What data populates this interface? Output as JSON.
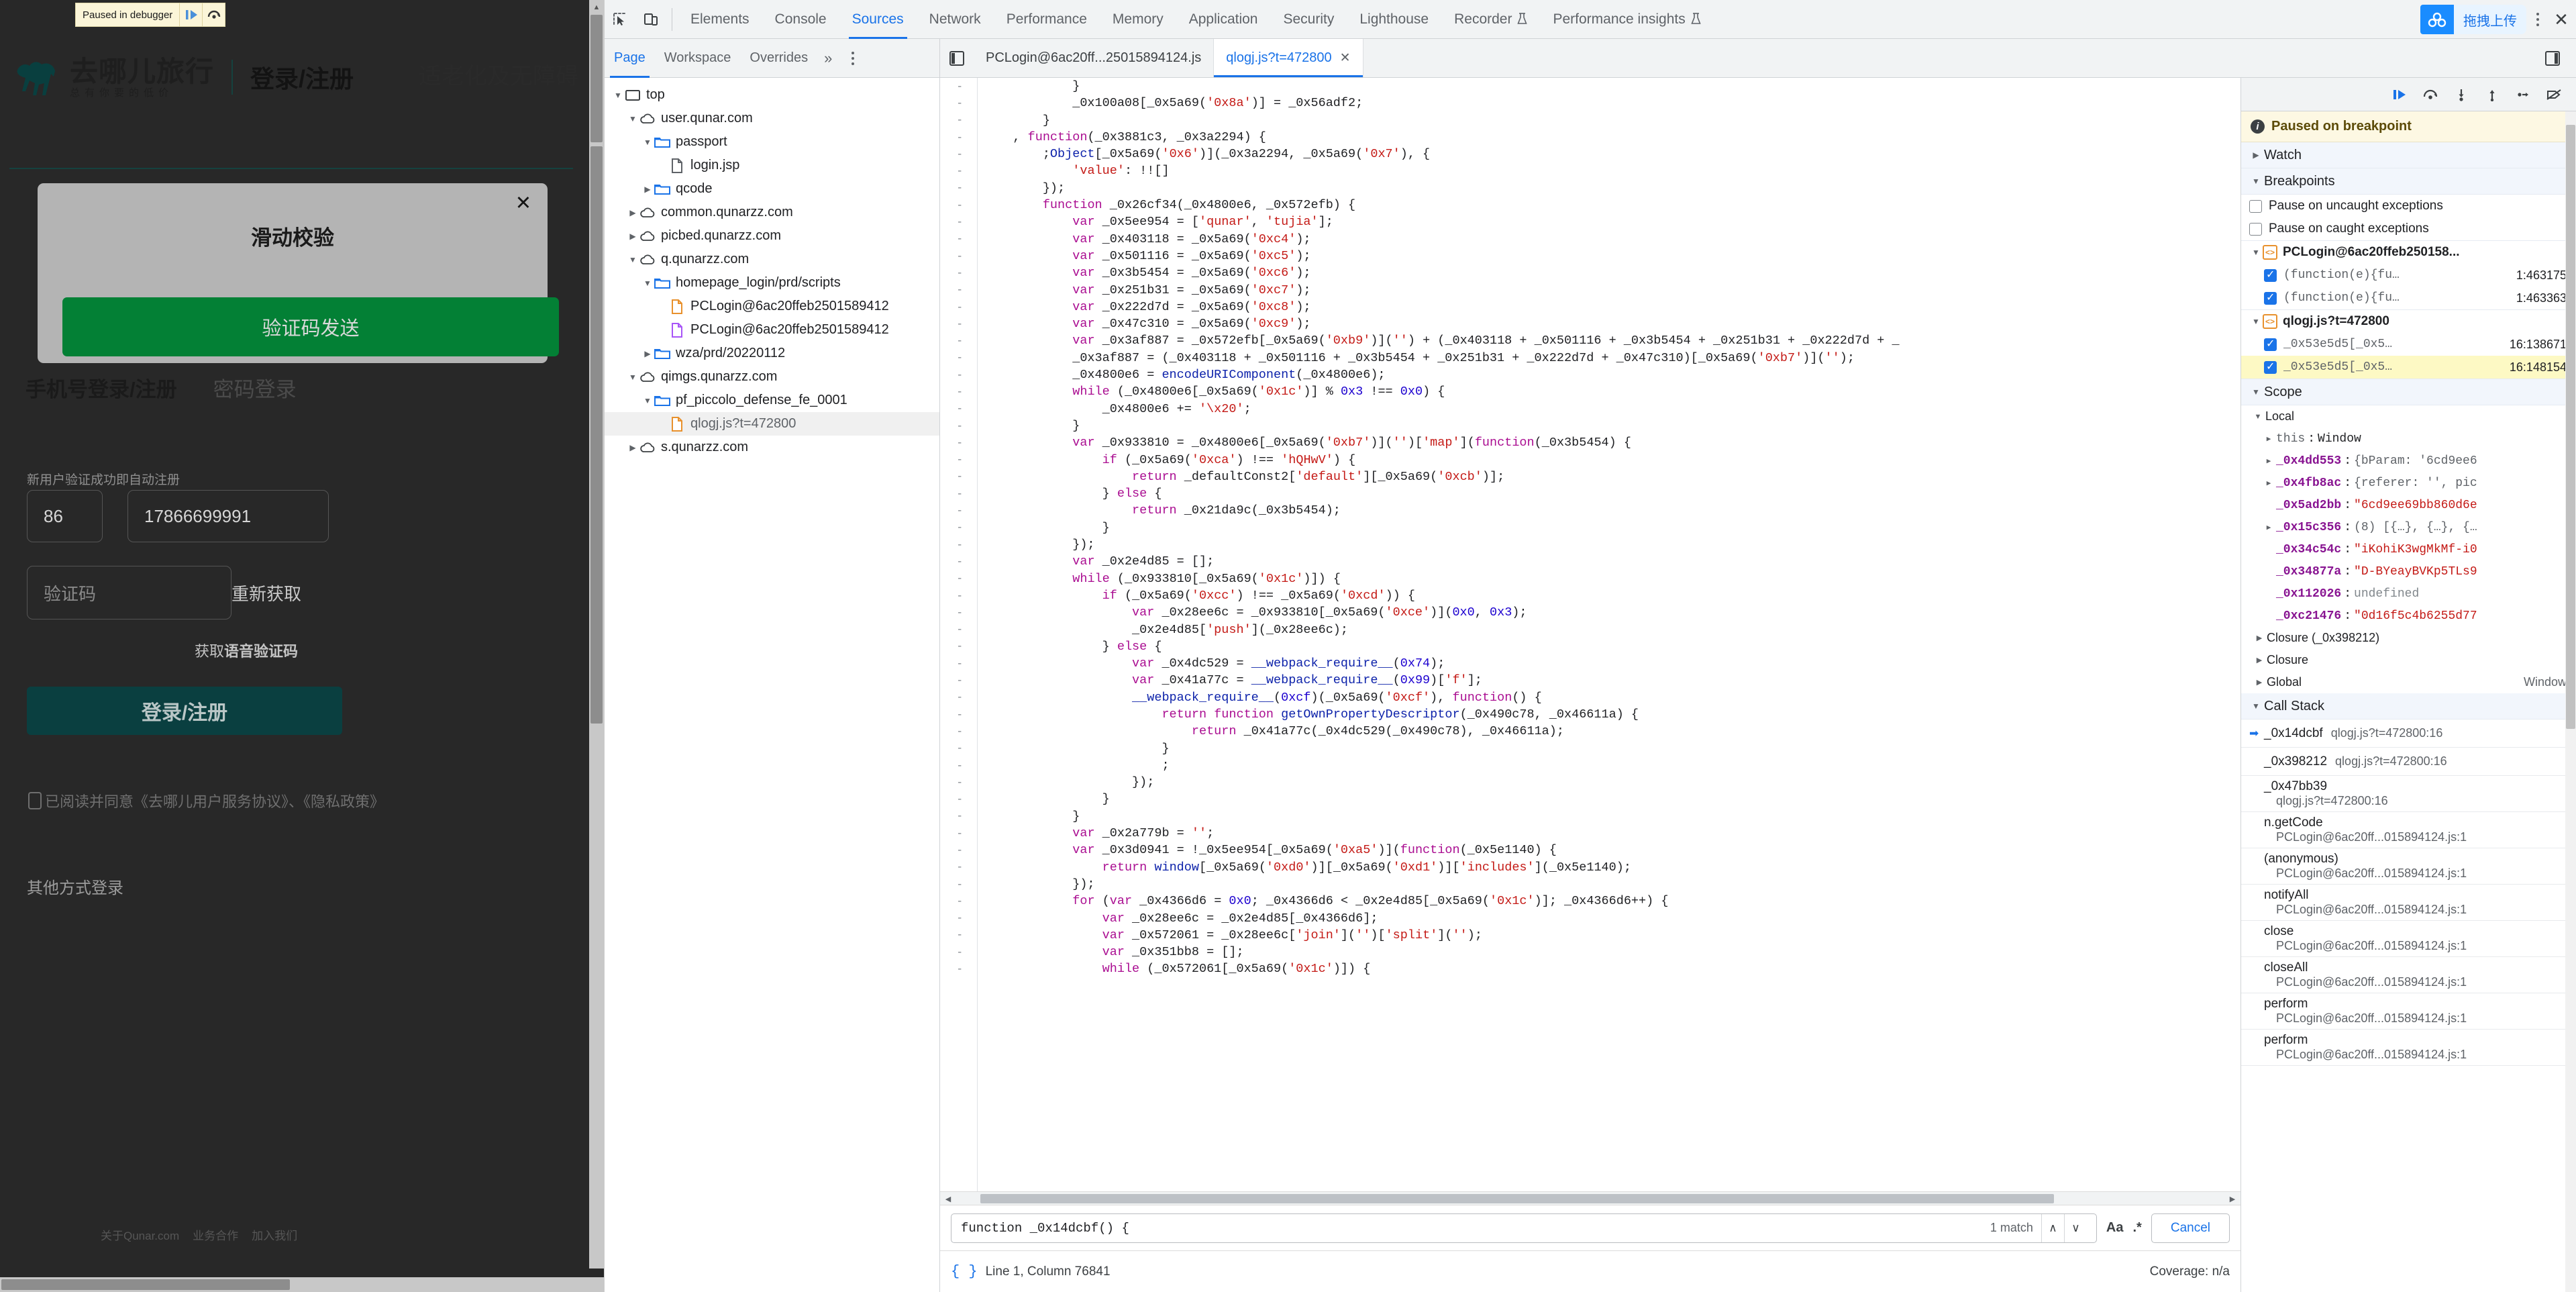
{
  "page": {
    "brand": {
      "name": "去哪儿旅行",
      "slogan": "总有你要的低价"
    },
    "header": {
      "login_word": "登录/注册",
      "accessibility": "适老化及无障碍"
    },
    "paused_banner": {
      "text": "Paused in debugger",
      "resume_icon": "resume-script-icon",
      "step_icon": "step-over-icon"
    },
    "verify_modal": {
      "title": "滑动校验",
      "slider_text": "验证码发送",
      "close_icon": "close-icon"
    },
    "tabs": {
      "active": "手机号登录/注册",
      "inactive": "密码登录"
    },
    "hint": "新用户验证成功即自动注册",
    "country_code": "86",
    "phone": "17866699991",
    "code_placeholder": "验证码",
    "resend": "重新获取",
    "voice_prefix": "获取",
    "voice_bold": "语音验证码",
    "login_button": "登录/注册",
    "agreement": "已阅读并同意《去哪儿用户服务协议》、《隐私政策》",
    "other_login": "其他方式登录",
    "footer": [
      "关于Qunar.com",
      "业务合作",
      "加入我们"
    ]
  },
  "devtools": {
    "left_icons": [
      "inspect-element-icon",
      "device-toolbar-icon"
    ],
    "panels": [
      {
        "label": "Elements",
        "active": false,
        "flask": false
      },
      {
        "label": "Console",
        "active": false,
        "flask": false
      },
      {
        "label": "Sources",
        "active": true,
        "flask": false
      },
      {
        "label": "Network",
        "active": false,
        "flask": false
      },
      {
        "label": "Performance",
        "active": false,
        "flask": false
      },
      {
        "label": "Memory",
        "active": false,
        "flask": false
      },
      {
        "label": "Application",
        "active": false,
        "flask": false
      },
      {
        "label": "Security",
        "active": false,
        "flask": false
      },
      {
        "label": "Lighthouse",
        "active": false,
        "flask": false
      },
      {
        "label": "Recorder",
        "active": false,
        "flask": true
      },
      {
        "label": "Performance insights",
        "active": false,
        "flask": true
      }
    ],
    "upload_chip": {
      "label": "拖拽上传",
      "icon": "cloud-upload-icon"
    },
    "more_icon": "more-vertical-icon",
    "close_icon": "close-devtools-icon",
    "nav_tabs": [
      {
        "label": "Page",
        "active": true
      },
      {
        "label": "Workspace",
        "active": false
      },
      {
        "label": "Overrides",
        "active": false
      }
    ],
    "nav_more": "»",
    "nav_menu_icon": "more-vertical-icon",
    "panel_toggle_icon": "toggle-navigator-icon",
    "file_tabs": [
      {
        "label": "PCLogin@6ac20ff...25015894124.js",
        "active": false,
        "closable": false
      },
      {
        "label": "qlogj.js?t=472800",
        "active": true,
        "closable": true
      }
    ],
    "tree": [
      {
        "depth": 0,
        "twisty": "down",
        "icon": "frame-icon",
        "label": "top"
      },
      {
        "depth": 1,
        "twisty": "down",
        "icon": "cloud-icon",
        "label": "user.qunar.com"
      },
      {
        "depth": 2,
        "twisty": "down",
        "icon": "folder-blue-icon",
        "label": "passport"
      },
      {
        "depth": 3,
        "twisty": "none",
        "icon": "file-gray-icon",
        "label": "login.jsp"
      },
      {
        "depth": 2,
        "twisty": "right",
        "icon": "folder-blue-icon",
        "label": "qcode"
      },
      {
        "depth": 1,
        "twisty": "right",
        "icon": "cloud-icon",
        "label": "common.qunarzz.com"
      },
      {
        "depth": 1,
        "twisty": "right",
        "icon": "cloud-icon",
        "label": "picbed.qunarzz.com"
      },
      {
        "depth": 1,
        "twisty": "down",
        "icon": "cloud-icon",
        "label": "q.qunarzz.com"
      },
      {
        "depth": 2,
        "twisty": "down",
        "icon": "folder-blue-icon",
        "label": "homepage_login/prd/scripts"
      },
      {
        "depth": 3,
        "twisty": "none",
        "icon": "file-orange-icon",
        "label": "PCLogin@6ac20ffeb2501589412"
      },
      {
        "depth": 3,
        "twisty": "none",
        "icon": "file-purple-icon",
        "label": "PCLogin@6ac20ffeb2501589412"
      },
      {
        "depth": 2,
        "twisty": "right",
        "icon": "folder-blue-icon",
        "label": "wza/prd/20220112"
      },
      {
        "depth": 1,
        "twisty": "down",
        "icon": "cloud-icon",
        "label": "qimgs.qunarzz.com"
      },
      {
        "depth": 2,
        "twisty": "down",
        "icon": "folder-blue-icon",
        "label": "pf_piccolo_defense_fe_0001"
      },
      {
        "depth": 3,
        "twisty": "none",
        "icon": "file-orange-icon",
        "label": "qlogj.js?t=472800",
        "selected": true
      },
      {
        "depth": 1,
        "twisty": "right",
        "icon": "cloud-icon",
        "label": "s.qunarzz.com"
      }
    ],
    "code_lines": [
      "            }",
      "            _0x100a08[_0x5a69('0x8a')] = _0x56adf2;",
      "        }",
      "    , function(_0x3881c3, _0x3a2294) {",
      "        ;Object[_0x5a69('0x6')](_0x3a2294, _0x5a69('0x7'), {",
      "            'value': !![]",
      "        });",
      "        function _0x26cf34(_0x4800e6, _0x572efb) {",
      "            var _0x5ee954 = ['qunar', 'tujia'];",
      "            var _0x403118 = _0x5a69('0xc4');",
      "            var _0x501116 = _0x5a69('0xc5');",
      "            var _0x3b5454 = _0x5a69('0xc6');",
      "            var _0x251b31 = _0x5a69('0xc7');",
      "            var _0x222d7d = _0x5a69('0xc8');",
      "            var _0x47c310 = _0x5a69('0xc9');",
      "            var _0x3af887 = _0x572efb[_0x5a69('0xb9')]('') + (_0x403118 + _0x501116 + _0x3b5454 + _0x251b31 + _0x222d7d + _",
      "            _0x3af887 = (_0x403118 + _0x501116 + _0x3b5454 + _0x251b31 + _0x222d7d + _0x47c310)[_0x5a69('0xb7')]('');",
      "            _0x4800e6 = encodeURIComponent(_0x4800e6);",
      "            while (_0x4800e6[_0x5a69('0x1c')] % 0x3 !== 0x0) {",
      "                _0x4800e6 += '\\x20';",
      "            }",
      "            var _0x933810 = _0x4800e6[_0x5a69('0xb7')]('')['map'](function(_0x3b5454) {",
      "                if (_0x5a69('0xca') !== 'hQHwV') {",
      "                    return _defaultConst2['default'][_0x5a69('0xcb')];",
      "                } else {",
      "                    return _0x21da9c(_0x3b5454);",
      "                }",
      "            });",
      "            var _0x2e4d85 = [];",
      "            while (_0x933810[_0x5a69('0x1c')]) {",
      "                if (_0x5a69('0xcc') !== _0x5a69('0xcd')) {",
      "                    var _0x28ee6c = _0x933810[_0x5a69('0xce')](0x0, 0x3);",
      "                    _0x2e4d85['push'](_0x28ee6c);",
      "                } else {",
      "                    var _0x4dc529 = __webpack_require__(0x74);",
      "                    var _0x41a77c = __webpack_require__(0x99)['f'];",
      "                    __webpack_require__(0xcf)(_0x5a69('0xcf'), function() {",
      "                        return function getOwnPropertyDescriptor(_0x490c78, _0x46611a) {",
      "                            return _0x41a77c(_0x4dc529(_0x490c78), _0x46611a);",
      "                        }",
      "                        ;",
      "                    });",
      "                }",
      "            }",
      "            var _0x2a779b = '';",
      "            var _0x3d0941 = !_0x5ee954[_0x5a69('0xa5')](function(_0x5e1140) {",
      "                return window[_0x5a69('0xd0')][_0x5a69('0xd1')]['includes'](_0x5e1140);",
      "            });",
      "            for (var _0x4366d6 = 0x0; _0x4366d6 < _0x2e4d85[_0x5a69('0x1c')]; _0x4366d6++) {",
      "                var _0x28ee6c = _0x2e4d85[_0x4366d6];",
      "                var _0x572061 = _0x28ee6c['join']('')['split']('');",
      "                var _0x351bb8 = [];",
      "                while (_0x572061[_0x5a69('0x1c')]) {"
    ],
    "search": {
      "query": "function _0x14dcbf() {",
      "match_count": "1 match",
      "prev_icon": "chevron-up-icon",
      "next_icon": "chevron-down-icon",
      "match_case_icon": "Aa",
      "regex_icon": ".*",
      "cancel_label": "Cancel"
    },
    "status": {
      "format_icon": "pretty-print-icon",
      "position": "Line 1, Column 76841",
      "coverage": "Coverage: n/a"
    },
    "debugger": {
      "toolbar_icons": [
        "resume-icon",
        "step-over-icon",
        "step-into-icon",
        "step-out-icon",
        "step-icon",
        "deactivate-breakpoints-icon"
      ],
      "paused_text": "Paused on breakpoint",
      "watch_label": "Watch",
      "breakpoints_label": "Breakpoints",
      "pause_uncaught": "Pause on uncaught exceptions",
      "pause_caught": "Pause on caught exceptions",
      "breakpoint_groups": [
        {
          "file": "PCLogin@6ac20ffeb250158...",
          "items": [
            {
              "code": "(function(e){fu…",
              "loc": "1:463175",
              "checked": true,
              "highlight": false
            },
            {
              "code": "(function(e){fu…",
              "loc": "1:463363",
              "checked": true,
              "highlight": false
            }
          ]
        },
        {
          "file": "qlogj.js?t=472800",
          "items": [
            {
              "code": "_0x53e5d5[_0x5…",
              "loc": "16:138671",
              "checked": true,
              "highlight": false
            },
            {
              "code": "_0x53e5d5[_0x5…",
              "loc": "16:148154",
              "checked": true,
              "highlight": true
            }
          ]
        }
      ],
      "scope_label": "Scope",
      "local_label": "Local",
      "scope_rows": [
        {
          "twisty": "right",
          "key": "this",
          "plain": true,
          "value": "Window",
          "kind": "plain"
        },
        {
          "twisty": "right",
          "key": "_0x4dd553",
          "value": "{bParam: '6cd9ee6",
          "kind": "obj"
        },
        {
          "twisty": "right",
          "key": "_0x4fb8ac",
          "value": "{referer: '', pic",
          "kind": "obj"
        },
        {
          "twisty": "none",
          "key": "_0x5ad2bb",
          "value": "\"6cd9ee69bb860d6e",
          "kind": "str"
        },
        {
          "twisty": "right",
          "key": "_0x15c356",
          "value": "(8) [{…}, {…}, {…",
          "kind": "obj"
        },
        {
          "twisty": "none",
          "key": "_0x34c54c",
          "value": "\"iKohiK3wgMkMf-i0",
          "kind": "str"
        },
        {
          "twisty": "none",
          "key": "_0x34877a",
          "value": "\"D-BYeayBVKp5TLs9",
          "kind": "str"
        },
        {
          "twisty": "none",
          "key": "_0x112026",
          "value": "undefined",
          "kind": "undef"
        },
        {
          "twisty": "none",
          "key": "_0xc21476",
          "value": "\"0d16f5c4b6255d77",
          "kind": "str"
        }
      ],
      "closures": [
        {
          "label": "Closure (_0x398212)"
        },
        {
          "label": "Closure"
        }
      ],
      "global": {
        "label": "Global",
        "value": "Window"
      },
      "call_stack_label": "Call Stack",
      "call_stack": [
        {
          "fn": "_0x14dcbf",
          "loc": "qlogj.js?t=472800:16",
          "current": true,
          "wrap": false
        },
        {
          "fn": "_0x398212",
          "loc": "qlogj.js?t=472800:16",
          "current": false,
          "wrap": false
        },
        {
          "fn": "_0x47bb39",
          "loc": "qlogj.js?t=472800:16",
          "current": false,
          "wrap": true
        },
        {
          "fn": "n.getCode",
          "loc": "PCLogin@6ac20ff...015894124.js:1",
          "current": false,
          "wrap": true
        },
        {
          "fn": "(anonymous)",
          "loc": "PCLogin@6ac20ff...015894124.js:1",
          "current": false,
          "wrap": true
        },
        {
          "fn": "notifyAll",
          "loc": "PCLogin@6ac20ff...015894124.js:1",
          "current": false,
          "wrap": true
        },
        {
          "fn": "close",
          "loc": "PCLogin@6ac20ff...015894124.js:1",
          "current": false,
          "wrap": true
        },
        {
          "fn": "closeAll",
          "loc": "PCLogin@6ac20ff...015894124.js:1",
          "current": false,
          "wrap": true
        },
        {
          "fn": "perform",
          "loc": "PCLogin@6ac20ff...015894124.js:1",
          "current": false,
          "wrap": true
        },
        {
          "fn": "perform",
          "loc": "PCLogin@6ac20ff...015894124.js:1",
          "current": false,
          "wrap": true
        }
      ]
    }
  }
}
